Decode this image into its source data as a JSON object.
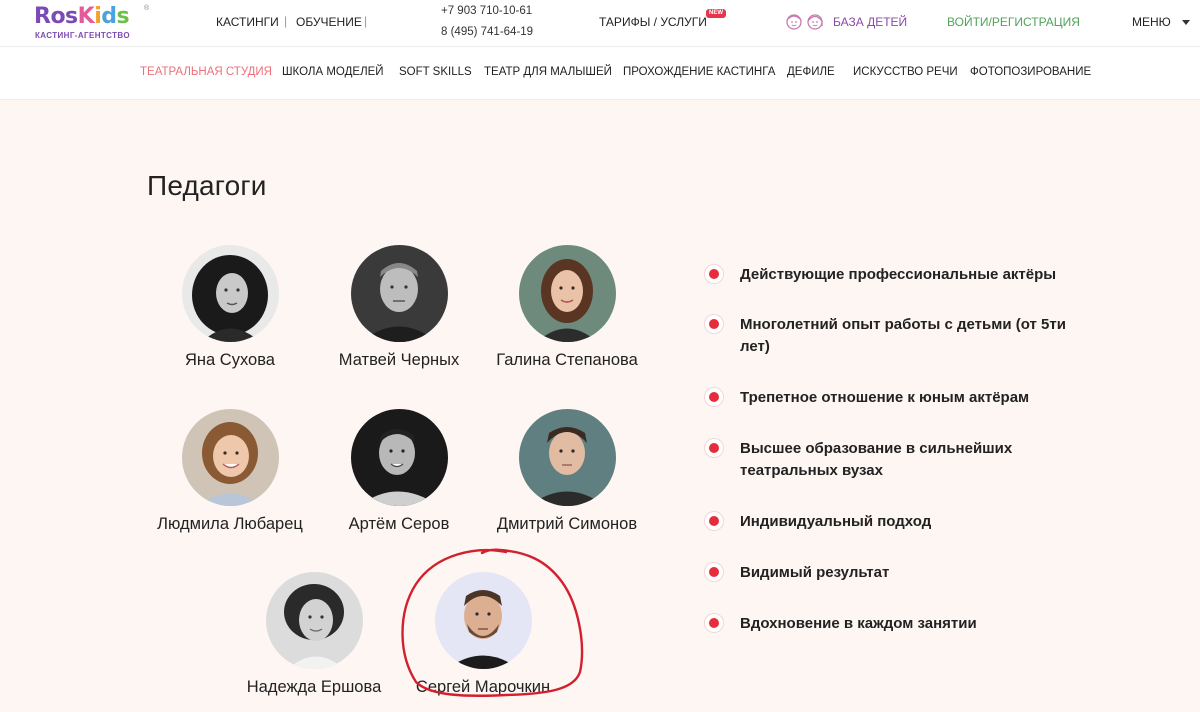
{
  "header": {
    "logo": {
      "word_parts": [
        "Ros",
        "K",
        "i",
        "d",
        "s"
      ],
      "subtitle": "КАСТИНГ-АГЕНТСТВО",
      "reg_mark": "®"
    },
    "nav": [
      "КАСТИНГИ",
      "ОБУЧЕНИЕ"
    ],
    "separator": "|",
    "phones": [
      "+7 903 710-10-61",
      "8 (495) 741-64-19"
    ],
    "tariffs": "ТАРИФЫ / УСЛУГИ",
    "new_badge": "NEW",
    "kids_base": "БАЗА ДЕТЕЙ",
    "login": "ВОЙТИ/РЕГИСТРАЦИЯ",
    "menu": "МЕНЮ"
  },
  "subnav": {
    "active_index": 0,
    "items": [
      "ТЕАТРАЛЬНАЯ СТУДИЯ",
      "ШКОЛА МОДЕЛЕЙ",
      "SOFT SKILLS",
      "ТЕАТР ДЛЯ МАЛЫШЕЙ",
      "ПРОХОЖДЕНИЕ КАСТИНГА",
      "ДЕФИЛЕ",
      "ИСКУССТВО РЕЧИ",
      "ФОТОПОЗИРОВАНИЕ"
    ]
  },
  "teachers": {
    "title": "Педагоги",
    "items": [
      {
        "name": "Яна Сухова"
      },
      {
        "name": "Матвей Черных"
      },
      {
        "name": "Галина Степанова"
      },
      {
        "name": "Людмила Любарец"
      },
      {
        "name": "Артём Серов"
      },
      {
        "name": "Дмитрий Симонов"
      },
      {
        "name": "Надежда Ершова"
      },
      {
        "name": "Сергей Марочкин",
        "highlighted": true
      }
    ]
  },
  "features": [
    "Действующие профессиональные актёры",
    "Многолетний опыт работы с детьми (от 5ти лет)",
    "Трепетное отношение к юным актёрам",
    "Высшее образование в сильнейших театральных вузах",
    "Индивидуальный подход",
    "Видимый результат",
    "Вдохновение в каждом занятии"
  ],
  "colors": {
    "accent_red": "#e52d3c",
    "active_nav": "#ee6f7a",
    "kids_link": "#8a4aa8",
    "login_link": "#4fa35a",
    "page_bg": "#fdf6f3",
    "highlight_stroke": "#d3202f"
  }
}
